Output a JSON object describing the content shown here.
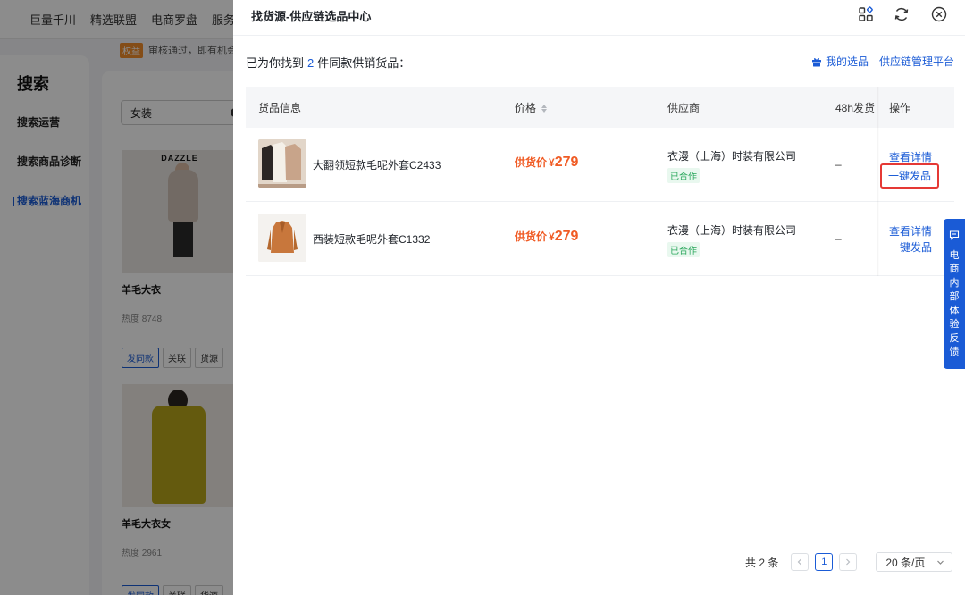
{
  "background": {
    "nav": [
      "巨量千川",
      "精选联盟",
      "电商罗盘",
      "服务"
    ],
    "notice_tag": "权益",
    "notice_text": "审核通过，即有机会",
    "sidebar": {
      "title": "搜索",
      "items": [
        "搜索运营",
        "搜索商品诊断",
        "搜索蓝海商机"
      ]
    },
    "search_value": "女装",
    "cards": [
      {
        "brand": "DAZZLE",
        "title": "羊毛大衣",
        "heat": "热度 8748",
        "buttons": [
          "发同款",
          "关联",
          "货源"
        ]
      },
      {
        "brand": "",
        "title": "羊毛大衣女",
        "heat": "热度 2961",
        "buttons": [
          "发同款",
          "关联",
          "货源"
        ]
      }
    ]
  },
  "drawer": {
    "title": "找货源-供应链选品中心",
    "result_prefix": "已为你找到",
    "result_count": "2",
    "result_suffix": "件同款供销货品：",
    "links": {
      "my_selection": "我的选品",
      "supply_platform": "供应链管理平台"
    },
    "columns": [
      "货品信息",
      "价格",
      "供应商",
      "48h发货",
      "操作"
    ],
    "rows": [
      {
        "name": "大翻领短款毛呢外套C2433",
        "price_label": "供货价",
        "currency": "¥",
        "price": "279",
        "supplier": "衣漫（上海）时装有限公司",
        "status": "已合作",
        "ship": "–",
        "action_view": "查看详情",
        "action_publish": "一键发品"
      },
      {
        "name": "西装短款毛呢外套C1332",
        "price_label": "供货价",
        "currency": "¥",
        "price": "279",
        "supplier": "衣漫（上海）时装有限公司",
        "status": "已合作",
        "ship": "–",
        "action_view": "查看详情",
        "action_publish": "一键发品"
      }
    ],
    "pagination": {
      "total": "共 2 条",
      "current": "1",
      "page_size": "20 条/页"
    }
  },
  "feedback": {
    "label": "电商内部体验反馈"
  },
  "colors": {
    "accent": "#1a5bd6",
    "price": "#f05b24",
    "cooperated": "#2aa75c",
    "highlight": "#e53935"
  }
}
